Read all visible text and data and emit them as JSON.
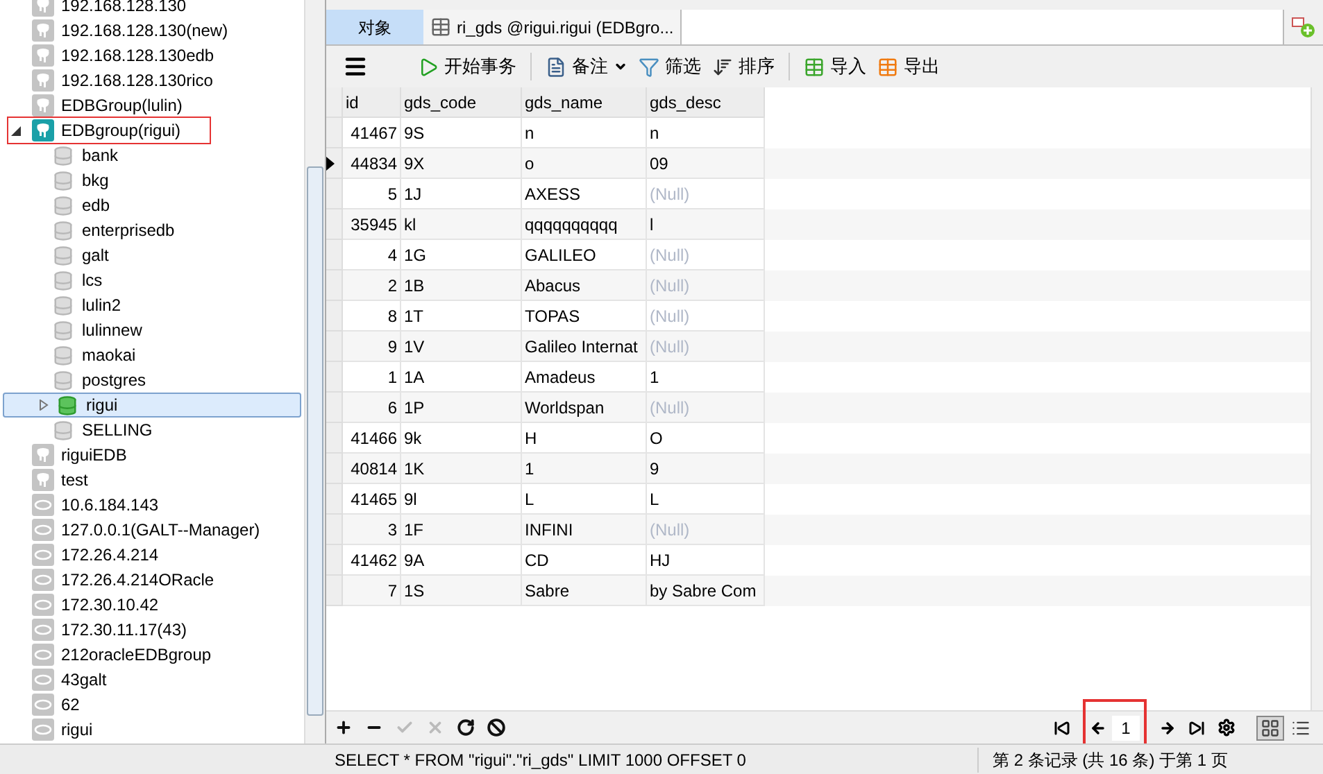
{
  "tree": [
    {
      "label": "192.168.128.130",
      "kind": "postgres",
      "connected": false
    },
    {
      "label": "192.168.128.130(new)",
      "kind": "postgres",
      "connected": false
    },
    {
      "label": "192.168.128.130edb",
      "kind": "postgres",
      "connected": false
    },
    {
      "label": "192.168.128.130rico",
      "kind": "postgres",
      "connected": false
    },
    {
      "label": "EDBGroup(lulin)",
      "kind": "postgres",
      "connected": false
    },
    {
      "label": "EDBgroup(rigui)",
      "kind": "postgres",
      "connected": true,
      "expanded": true,
      "highlighted": true,
      "children": [
        {
          "label": "bank",
          "open": false,
          "selected": false
        },
        {
          "label": "bkg",
          "open": false,
          "selected": false
        },
        {
          "label": "edb",
          "open": false,
          "selected": false
        },
        {
          "label": "enterprisedb",
          "open": false,
          "selected": false
        },
        {
          "label": "galt",
          "open": false,
          "selected": false
        },
        {
          "label": "lcs",
          "open": false,
          "selected": false
        },
        {
          "label": "lulin2",
          "open": false,
          "selected": false
        },
        {
          "label": "lulinnew",
          "open": false,
          "selected": false
        },
        {
          "label": "maokai",
          "open": false,
          "selected": false
        },
        {
          "label": "postgres",
          "open": false,
          "selected": false
        },
        {
          "label": "rigui",
          "open": true,
          "selected": true
        },
        {
          "label": "SELLING",
          "open": false,
          "selected": false
        }
      ]
    },
    {
      "label": "riguiEDB",
      "kind": "postgres",
      "connected": false
    },
    {
      "label": "test",
      "kind": "postgres",
      "connected": false
    },
    {
      "label": "10.6.184.143",
      "kind": "oracle",
      "connected": false
    },
    {
      "label": "127.0.0.1(GALT--Manager)",
      "kind": "oracle",
      "connected": false
    },
    {
      "label": "172.26.4.214",
      "kind": "oracle",
      "connected": false
    },
    {
      "label": "172.26.4.214ORacle",
      "kind": "oracle",
      "connected": false
    },
    {
      "label": "172.30.10.42",
      "kind": "oracle",
      "connected": false
    },
    {
      "label": "172.30.11.17(43)",
      "kind": "oracle",
      "connected": false
    },
    {
      "label": "212oracleEDBgroup",
      "kind": "oracle",
      "connected": false
    },
    {
      "label": "43galt",
      "kind": "oracle",
      "connected": false
    },
    {
      "label": "62",
      "kind": "oracle",
      "connected": false
    },
    {
      "label": "rigui",
      "kind": "oracle",
      "connected": false
    }
  ],
  "tabs": [
    {
      "label": "对象",
      "selected": true
    },
    {
      "label": "ri_gds @rigui.rigui (EDBgro...",
      "selected": false
    }
  ],
  "toolbar": [
    {
      "label": "开始事务",
      "kind": "transaction"
    },
    {
      "label": "备注",
      "kind": "memo"
    },
    {
      "label": "筛选",
      "kind": "filter"
    },
    {
      "label": "排序",
      "kind": "sort"
    },
    {
      "label": "导入",
      "kind": "import"
    },
    {
      "label": "导出",
      "kind": "export"
    }
  ],
  "table": {
    "columns": [
      "id",
      "gds_code",
      "gds_name",
      "gds_desc"
    ],
    "rows": [
      {
        "id": "41467",
        "gds_code": "9S",
        "gds_name": "n",
        "gds_desc": "n",
        "desc_null": false,
        "current": false
      },
      {
        "id": "44834",
        "gds_code": "9X",
        "gds_name": "o",
        "gds_desc": "09",
        "desc_null": false,
        "current": true
      },
      {
        "id": "5",
        "gds_code": "1J",
        "gds_name": "AXESS",
        "gds_desc": "(Null)",
        "desc_null": true,
        "current": false
      },
      {
        "id": "35945",
        "gds_code": "kl",
        "gds_name": "qqqqqqqqqq",
        "gds_desc": "l",
        "desc_null": false,
        "current": false
      },
      {
        "id": "4",
        "gds_code": "1G",
        "gds_name": "GALILEO",
        "gds_desc": "(Null)",
        "desc_null": true,
        "current": false
      },
      {
        "id": "2",
        "gds_code": "1B",
        "gds_name": "Abacus",
        "gds_desc": "(Null)",
        "desc_null": true,
        "current": false
      },
      {
        "id": "8",
        "gds_code": "1T",
        "gds_name": "TOPAS",
        "gds_desc": "(Null)",
        "desc_null": true,
        "current": false
      },
      {
        "id": "9",
        "gds_code": "1V",
        "gds_name": "Galileo Internat",
        "gds_desc": "(Null)",
        "desc_null": true,
        "current": false
      },
      {
        "id": "1",
        "gds_code": "1A",
        "gds_name": "Amadeus",
        "gds_desc": "1",
        "desc_null": false,
        "current": false
      },
      {
        "id": "6",
        "gds_code": "1P",
        "gds_name": "Worldspan",
        "gds_desc": "(Null)",
        "desc_null": true,
        "current": false
      },
      {
        "id": "41466",
        "gds_code": "9k",
        "gds_name": "H",
        "gds_desc": "O",
        "desc_null": false,
        "current": false
      },
      {
        "id": "40814",
        "gds_code": "1K",
        "gds_name": "1",
        "gds_desc": "9",
        "desc_null": false,
        "current": false
      },
      {
        "id": "41465",
        "gds_code": "9l",
        "gds_name": "L",
        "gds_desc": "L",
        "desc_null": false,
        "current": false
      },
      {
        "id": "3",
        "gds_code": "1F",
        "gds_name": "INFINI",
        "gds_desc": "(Null)",
        "desc_null": true,
        "current": false
      },
      {
        "id": "41462",
        "gds_code": "9A",
        "gds_name": "CD",
        "gds_desc": "HJ",
        "desc_null": false,
        "current": false
      },
      {
        "id": "7",
        "gds_code": "1S",
        "gds_name": "Sabre",
        "gds_desc": "by Sabre Com",
        "desc_null": false,
        "current": false
      }
    ]
  },
  "bottom_bar": {
    "actions": [
      {
        "kind": "add",
        "disabled": false
      },
      {
        "kind": "delete",
        "disabled": false
      },
      {
        "kind": "apply",
        "disabled": true
      },
      {
        "kind": "discard",
        "disabled": true
      },
      {
        "kind": "refresh",
        "disabled": false
      },
      {
        "kind": "stop",
        "disabled": false
      }
    ],
    "page": {
      "value": "1",
      "highlighted": true
    },
    "views": [
      {
        "kind": "grid",
        "selected": true
      },
      {
        "kind": "form",
        "selected": false
      }
    ]
  },
  "status_bar": {
    "query": "SELECT * FROM \"rigui\".\"ri_gds\" LIMIT 1000 OFFSET 0",
    "record": "第 2 条记录 (共 16 条) 于第 1 页"
  }
}
